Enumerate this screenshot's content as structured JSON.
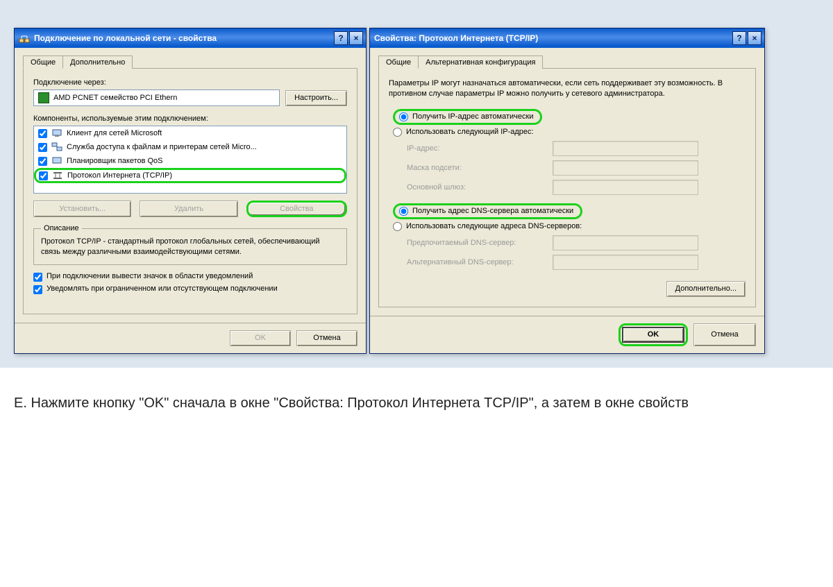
{
  "dialog_left": {
    "title": "Подключение по локальной сети - свойства",
    "help": "?",
    "close": "×",
    "tabs": {
      "general": "Общие",
      "advanced": "Дополнительно"
    },
    "connect_via_label": "Подключение через:",
    "adapter": "AMD PCNET семейство PCI Ethern",
    "configure_btn": "Настроить...",
    "components_label": "Компоненты, используемые этим подключением:",
    "components": [
      "Клиент для сетей Microsoft",
      "Служба доступа к файлам и принтерам сетей Micro...",
      "Планировщик пакетов QoS",
      "Протокол Интернета (TCP/IP)"
    ],
    "install_btn": "Установить...",
    "remove_btn": "Удалить",
    "properties_btn": "Свойства",
    "description_legend": "Описание",
    "description_text": "Протокол TCP/IP - стандартный протокол глобальных сетей, обеспечивающий связь между различными взаимодействующими сетями.",
    "notify_icon": "При подключении вывести значок в области уведомлений",
    "notify_limited": "Уведомлять при ограниченном или отсутствующем подключении",
    "ok": "OK",
    "cancel": "Отмена"
  },
  "dialog_right": {
    "title": "Свойства: Протокол Интернета (TCP/IP)",
    "help": "?",
    "close": "×",
    "tabs": {
      "general": "Общие",
      "alt": "Альтернативная конфигурация"
    },
    "info": "Параметры IP могут назначаться автоматически, если сеть поддерживает эту возможность. В противном случае параметры IP можно получить у сетевого администратора.",
    "radio_ip_auto": "Получить IP-адрес автоматически",
    "radio_ip_manual": "Использовать следующий IP-адрес:",
    "ip_label": "IP-адрес:",
    "mask_label": "Маска подсети:",
    "gateway_label": "Основной шлюз:",
    "radio_dns_auto": "Получить адрес DNS-сервера автоматически",
    "radio_dns_manual": "Использовать следующие адреса DNS-серверов:",
    "dns_pref_label": "Предпочитаемый DNS-сервер:",
    "dns_alt_label": "Альтернативный DNS-сервер:",
    "advanced_btn": "Дополнительно...",
    "ok": "OK",
    "cancel": "Отмена"
  },
  "instruction": "Е. Нажмите кнопку \"OK\" сначала в окне \"Свойства: Протокол Интернета TCP/IP\", а затем в окне свойств"
}
